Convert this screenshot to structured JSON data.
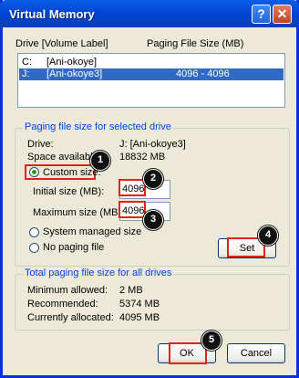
{
  "window": {
    "title": "Virtual Memory",
    "help_glyph": "?",
    "close_glyph": "✕"
  },
  "drives": {
    "header_drive": "Drive  [Volume Label]",
    "header_paging": "Paging File Size (MB)",
    "rows": [
      {
        "letter": "C:",
        "label": "[Ani-okoye]",
        "size": "",
        "selected": false
      },
      {
        "letter": "J:",
        "label": "[Ani-okoye3]",
        "size": "4096 - 4096",
        "selected": true
      }
    ]
  },
  "selected_drive_group": {
    "title": "Paging file size for selected drive",
    "drive_label": "Drive:",
    "drive_value": "J:  [Ani-okoye3]",
    "space_label": "Space available:",
    "space_value": "18832 MB",
    "custom_size_label": "Custom size:",
    "initial_label": "Initial size (MB):",
    "initial_value": "4096",
    "maximum_label": "Maximum size (MB):",
    "maximum_value": "4096",
    "system_managed_label": "System managed size",
    "no_paging_label": "No paging file",
    "set_label": "Set",
    "selected_option": "custom_size"
  },
  "total_group": {
    "title": "Total paging file size for all drives",
    "min_label": "Minimum allowed:",
    "min_value": "2 MB",
    "rec_label": "Recommended:",
    "rec_value": "5374 MB",
    "cur_label": "Currently allocated:",
    "cur_value": "4095 MB"
  },
  "buttons": {
    "ok_label": "OK",
    "cancel_label": "Cancel"
  },
  "callouts": [
    "1",
    "2",
    "3",
    "4",
    "5"
  ],
  "colors": {
    "title_bar": "#0a5ee8",
    "highlight": "#e2231a",
    "selection": "#316ac5",
    "group_label": "#0046d5"
  }
}
